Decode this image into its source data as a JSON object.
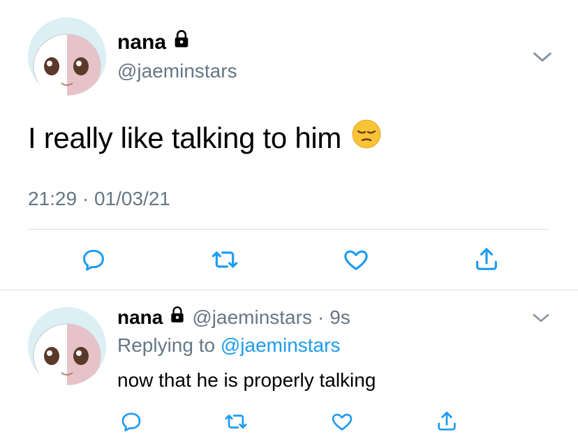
{
  "main_tweet": {
    "user": {
      "display_name": "nana",
      "handle": "@jaeminstars"
    },
    "text": "I really like talking to him",
    "emoji": "pensive-face",
    "time": "21:29",
    "separator": " · ",
    "date": "01/03/21"
  },
  "reply_tweet": {
    "user": {
      "display_name": "nana",
      "handle": "@jaeminstars"
    },
    "separator": "·",
    "age": "9s",
    "replying_prefix": "Replying to",
    "replying_mention": "@jaeminstars",
    "text": "now that he is properly talking"
  },
  "colors": {
    "secondary_text": "#667786",
    "mention_blue": "#1d9bf0",
    "icon_blue": "#1d9bf0",
    "divider": "#dcdfe2"
  },
  "icons": [
    "lock-icon",
    "chevron-down-icon",
    "reply-icon",
    "retweet-icon",
    "like-icon",
    "share-icon"
  ]
}
